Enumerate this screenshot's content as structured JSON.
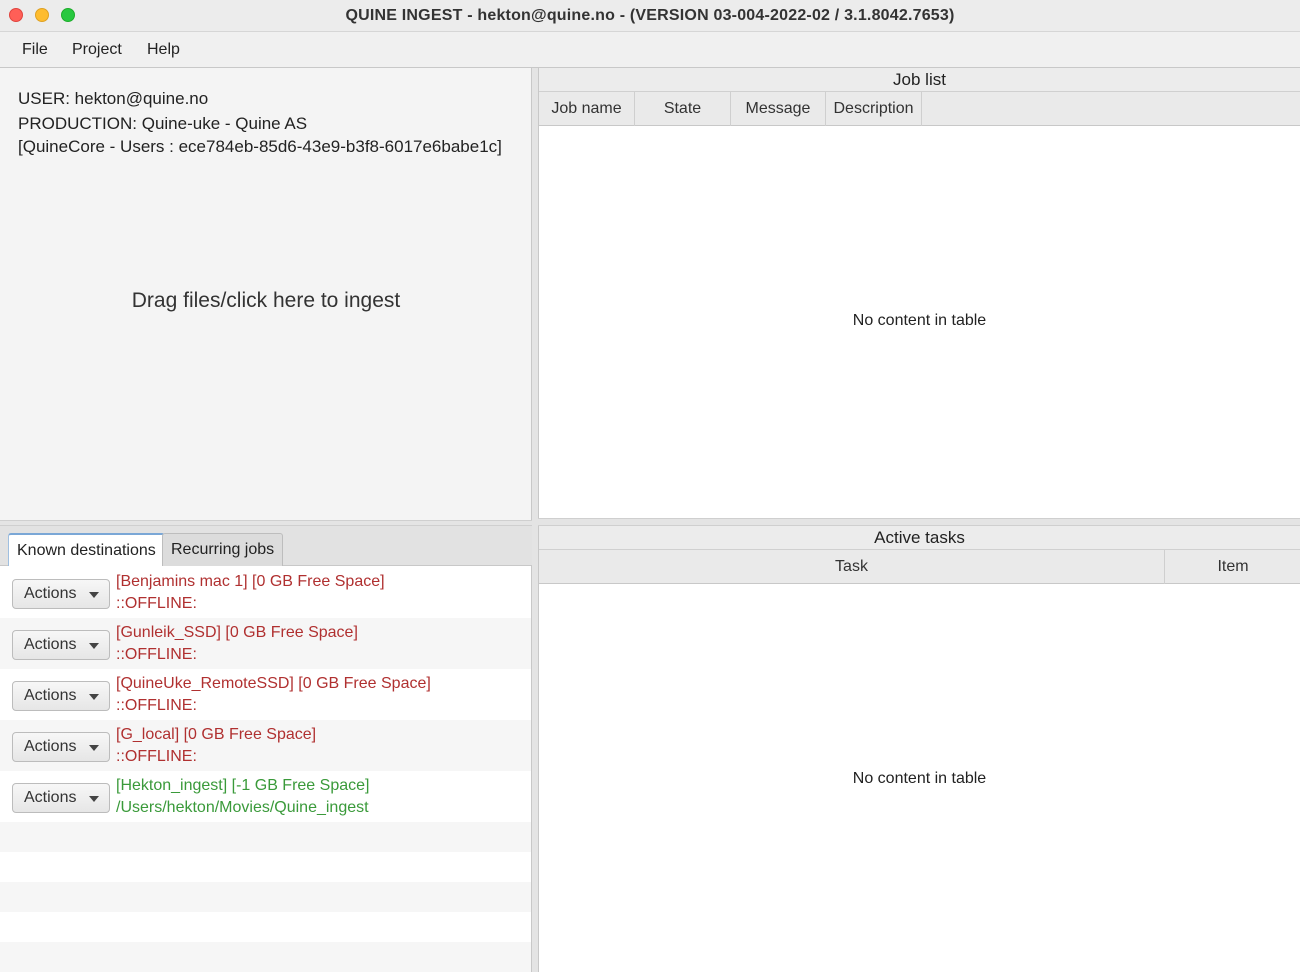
{
  "window": {
    "title": "QUINE INGEST - hekton@quine.no - (VERSION 03-004-2022-02 / 3.1.8042.7653)"
  },
  "menu": {
    "file": "File",
    "project": "Project",
    "help": "Help"
  },
  "ingest": {
    "user": "USER: hekton@quine.no",
    "production": "PRODUCTION: Quine-uke - Quine AS",
    "core": "[QuineCore - Users : ece784eb-85d6-43e9-b3f8-6017e6babe1c]",
    "drop_text": "Drag files/click here to ingest"
  },
  "tabs": {
    "known": "Known destinations",
    "recurring": "Recurring jobs"
  },
  "destinations": [
    {
      "action": "Actions",
      "line1": "[Benjamins mac 1] [0 GB Free Space]",
      "line2": "::OFFLINE:",
      "status_color": "#b03030"
    },
    {
      "action": "Actions",
      "line1": "[Gunleik_SSD] [0 GB Free Space]",
      "line2": "::OFFLINE:",
      "status_color": "#b03030"
    },
    {
      "action": "Actions",
      "line1": "[QuineUke_RemoteSSD] [0 GB Free Space]",
      "line2": "::OFFLINE:",
      "status_color": "#b03030"
    },
    {
      "action": "Actions",
      "line1": "[G_local] [0 GB Free Space]",
      "line2": "::OFFLINE:",
      "status_color": "#b03030"
    },
    {
      "action": "Actions",
      "line1": "[Hekton_ingest] [-1 GB Free Space]",
      "line2": "/Users/hekton/Movies/Quine_ingest",
      "status_color": "#3a9a3a"
    }
  ],
  "joblist": {
    "title": "Job list",
    "columns": [
      "Job name",
      "State",
      "Message",
      "Description"
    ],
    "empty": "No content in table"
  },
  "tasks": {
    "title": "Active tasks",
    "columns": [
      "Task",
      "Item"
    ],
    "empty": "No content in table"
  }
}
